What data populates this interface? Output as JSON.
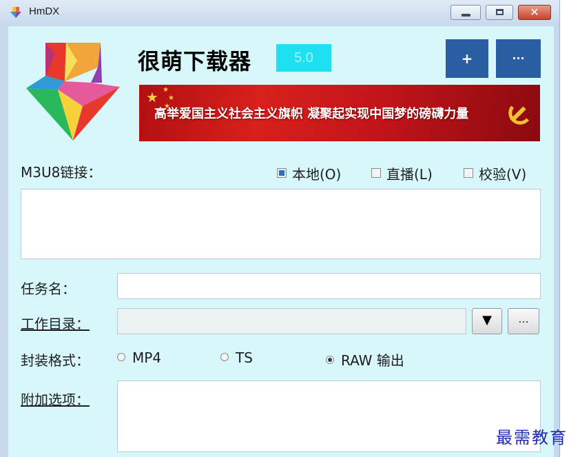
{
  "window": {
    "title": "HmDX",
    "controls": {
      "minimize_icon": "minimize-icon",
      "maximize_icon": "maximize-icon",
      "close_label": "✕"
    }
  },
  "header": {
    "app_name": "很萌下载器",
    "version": "5.0",
    "add_label": "+",
    "more_label": "···"
  },
  "banner": {
    "text": "高举爱国主义社会主义旗帜 凝聚起实现中国梦的磅礴力量"
  },
  "m3u8": {
    "label": "M3U8链接：",
    "value": "",
    "options": [
      {
        "label": "本地(O)",
        "checked": true
      },
      {
        "label": "直播(L)",
        "checked": false
      },
      {
        "label": "校验(V)",
        "checked": false
      }
    ]
  },
  "task": {
    "label": "任务名：",
    "value": ""
  },
  "workdir": {
    "label": "工作目录：",
    "value": "",
    "dropdown_label": "▼",
    "browse_label": "..."
  },
  "format": {
    "label": "封装格式：",
    "options": [
      {
        "label": "MP4",
        "selected": false
      },
      {
        "label": "TS",
        "selected": false
      },
      {
        "label": "RAW 输出",
        "selected": true
      }
    ]
  },
  "extra": {
    "label": "附加选项：",
    "value": ""
  },
  "watermark": {
    "text": "最需教育"
  },
  "colors": {
    "client_bg": "#d7f7fa",
    "button_blue": "#2a5ea0",
    "version_bg": "#1fe0f0",
    "banner_red": "#c2141a"
  }
}
